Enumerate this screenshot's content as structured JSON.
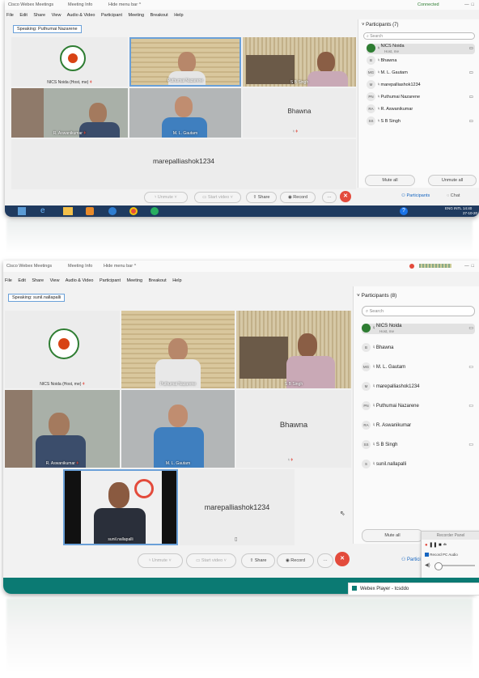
{
  "window1": {
    "titlebar": {
      "app_title": "Cisco Webex Meetings",
      "meeting_info": "Meeting Info",
      "hide_menu": "Hide menu bar ^",
      "connected": "Connected"
    },
    "menu": [
      "File",
      "Edit",
      "Share",
      "View",
      "Audio & Video",
      "Participant",
      "Meeting",
      "Breakout",
      "Help"
    ],
    "speaking": "Speaking: Puthumai Nazarene",
    "tiles": [
      {
        "name": "NICS Noida  (Host, me)"
      },
      {
        "name": "Puthumai Nazarene"
      },
      {
        "name": "S B Singh"
      },
      {
        "name": "R. Aswanikumar"
      },
      {
        "name": "M. L. Gautam"
      },
      {
        "name": "Bhawna"
      }
    ],
    "big_name": "marepalliashok1234",
    "controls": {
      "unmute": "Unmute",
      "start_video": "Start video",
      "share": "Share",
      "record": "Record",
      "more": "···",
      "end": "✕",
      "participants": "Participants",
      "chat": "Chat"
    },
    "panel": {
      "title": "Participants (7)",
      "search_placeholder": "Search",
      "participants": [
        {
          "initials": "",
          "name": "NICS Noida",
          "sub": "Host, me"
        },
        {
          "initials": "B",
          "name": "Bhawna",
          "sub": ""
        },
        {
          "initials": "MG",
          "name": "M. L. Gautam",
          "sub": ""
        },
        {
          "initials": "M",
          "name": "marepalliashok1234",
          "sub": ""
        },
        {
          "initials": "PN",
          "name": "Puthumai Nazarene",
          "sub": ""
        },
        {
          "initials": "RA",
          "name": "R. Aswanikumar",
          "sub": ""
        },
        {
          "initials": "SS",
          "name": "S B Singh",
          "sub": ""
        }
      ],
      "mute_all": "Mute all",
      "unmute_all": "Unmute all"
    },
    "taskbar": {
      "time": "14:40",
      "date": "27-10-20",
      "lang": "ENG INTL"
    }
  },
  "window2": {
    "titlebar": {
      "app_title": "Cisco Webex Meetings",
      "meeting_info": "Meeting Info",
      "hide_menu": "Hide menu bar ^"
    },
    "menu": [
      "File",
      "Edit",
      "Share",
      "View",
      "Audio & Video",
      "Participant",
      "Meeting",
      "Breakout",
      "Help"
    ],
    "speaking": "Speaking: sunil.nallapalli",
    "tiles": [
      {
        "name": "NICS Noida  (Host, me)"
      },
      {
        "name": "Puthumai Nazarene"
      },
      {
        "name": "S B Singh"
      },
      {
        "name": "R. Aswanikumar"
      },
      {
        "name": "M. L. Gautam"
      },
      {
        "name": "Bhawna"
      },
      {
        "name": "sunil.nallapalli"
      }
    ],
    "big_name": "marepalliashok1234",
    "controls": {
      "unmute": "Unmute",
      "start_video": "Start video",
      "share": "Share",
      "record": "Record",
      "more": "···",
      "end": "✕",
      "participants": "Participants"
    },
    "panel": {
      "title": "Participants (8)",
      "search_placeholder": "Search",
      "participants": [
        {
          "initials": "",
          "name": "NICS Noida",
          "sub": "Host, me"
        },
        {
          "initials": "B",
          "name": "Bhawna",
          "sub": ""
        },
        {
          "initials": "MG",
          "name": "M. L. Gautam",
          "sub": ""
        },
        {
          "initials": "M",
          "name": "marepalliashok1234",
          "sub": ""
        },
        {
          "initials": "PN",
          "name": "Puthumai Nazarene",
          "sub": ""
        },
        {
          "initials": "RA",
          "name": "R. Aswanikumar",
          "sub": ""
        },
        {
          "initials": "SS",
          "name": "S B Singh",
          "sub": ""
        },
        {
          "initials": "S",
          "name": "sunil.nallapalli",
          "sub": ""
        }
      ],
      "mute_all": "Mute all"
    },
    "recorder": {
      "title": "Recorder Panel",
      "record_pc_audio": "Record PC Audio"
    },
    "player_bar": "Webex Player - tcsddo"
  },
  "colors": {
    "accent_blue": "#1565c0",
    "end_red": "#e34b3c",
    "taskbar": "#1f3a5f",
    "teal_bar": "#0b7a73"
  }
}
